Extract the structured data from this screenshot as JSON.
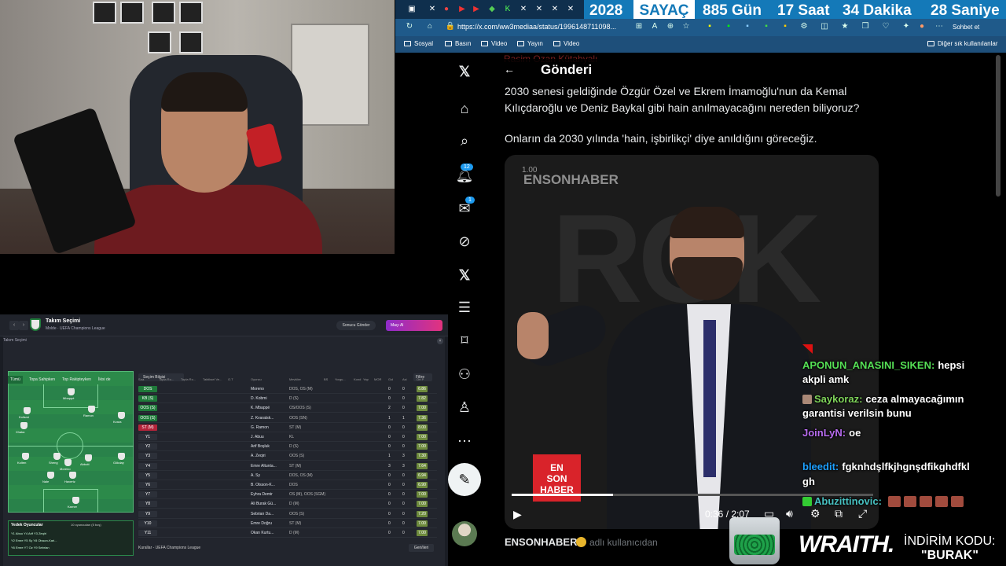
{
  "browser": {
    "url": "https://x.com/ww3mediaa/status/1996148711098...",
    "bookmarks": [
      "Sosyal",
      "Basın",
      "Yayın",
      "Video"
    ],
    "other_bookmarks": "Diğer sık kullanılanlar",
    "chat_button": "Sohbet et"
  },
  "counter": {
    "year": "2028",
    "label": "SAYAÇ",
    "days": "885 Gün",
    "hours": "17 Saat",
    "minutes": "34 Dakika",
    "seconds": "28 Saniye"
  },
  "x": {
    "header_title": "Gönderi",
    "faded_name": "Rasim Ozan Kütahyalı",
    "tweet_lines": [
      "2030 senesi geldiğinde Özgür Özel ve Ekrem İmamoğlu'nun da Kemal",
      "Kılıçdaroğlu ve Deniz Baykal gibi hain anılmayacağını nereden biliyoruz?",
      "Onların da 2030 yılında 'hain, işbirlikçi' diye anıldığını göreceğiz."
    ],
    "notifications_badge": "12",
    "messages_badge": "1",
    "video": {
      "speed": "1.00",
      "brand": "ENSONHABER",
      "bg_text": "ROK",
      "logo_lines": [
        "EN",
        "SON",
        "HABER"
      ],
      "time": "0:36 / 2:07",
      "progress": 0.28
    },
    "author": "ENSONHABER",
    "author_sub": "adlı kullanıcıdan"
  },
  "chat": [
    {
      "user": "APONUN_ANASINI_SIKEN:",
      "msg": "hepsi",
      "cont": "akpli amk",
      "color": "#55e055",
      "badge": "#d11"
    },
    {
      "user": "Saykoraz:",
      "msg": "ceza almayacağımın",
      "cont": "garantisi verilsin bunu",
      "color": "#7fd45a",
      "badge": "#a87"
    },
    {
      "user": "JoinLyN:",
      "msg": "oe",
      "cont": "",
      "color": "#b86cf0",
      "badge": ""
    },
    {
      "user": "bleedit:",
      "msg": "fgknhdşlfkjhgnşdfikghdfkl",
      "cont": "gh",
      "color": "#1ea0ff",
      "badge": ""
    },
    {
      "user": "Abuzittinovic:",
      "msg": "",
      "cont": "",
      "color": "#47c0c0",
      "badge": "#3c3"
    }
  ],
  "sponsor": {
    "brand": "WRAITH.",
    "code_label": "İNDİRİM KODU:",
    "code": "\"BURAK\""
  },
  "game": {
    "title": "Takım Seçimi",
    "subtitle": "Molde  ·  UEFA Champions League",
    "panel_title": "Takım Seçimi",
    "send_btn": "Sonucu Gönder",
    "play_btn": "Maçı Al",
    "pitch_tabs": [
      "Tümü",
      "Topa Sahipken",
      "Top Rakipteyken",
      "İkisi de"
    ],
    "selection_btn": "Seçim Bilgisi",
    "filter_btn": "Filtre",
    "headers": [
      "Sıra",
      "Topla Ro...",
      "Topla Ro...",
      "Taktiksel Ve...",
      "O.T",
      "Oyuncu",
      "Mevkiler",
      "BS",
      "Yorgu...",
      "Kond",
      "Yap",
      "MOR",
      "Gol",
      "Asi",
      "Ort P"
    ],
    "rows": [
      {
        "pos": "DOS",
        "name": "Moreno",
        "role": "DOS, OS (M)",
        "g": "0",
        "a": "0",
        "r": "6.86",
        "c": "#1f7a3a"
      },
      {
        "pos": "KB (S)",
        "name": "D. Kobmi",
        "role": "D (S)",
        "g": "0",
        "a": "0",
        "r": "7.82",
        "c": "#1f7a3a"
      },
      {
        "pos": "OOS (S)",
        "name": "K. Mbappé",
        "role": "OS/OOS (S)",
        "g": "2",
        "a": "0",
        "r": "7.00",
        "c": "#1f7a3a"
      },
      {
        "pos": "OOS (S)",
        "name": "Z. Kvaratsk...",
        "role": "OOS (SN)",
        "g": "1",
        "a": "1",
        "r": "7.36",
        "c": "#1f7a3a"
      },
      {
        "pos": "ST (M)",
        "name": "G. Ramon",
        "role": "ST (M)",
        "g": "0",
        "a": "0",
        "r": "8.00",
        "c": "#b3243a"
      },
      {
        "pos": "Y1",
        "name": "J. Abuu",
        "role": "KL",
        "g": "0",
        "a": "0",
        "r": "7.00",
        "c": "#2c3039"
      },
      {
        "pos": "Y2",
        "name": "Arif Boşluk",
        "role": "D (S)",
        "g": "0",
        "a": "0",
        "r": "7.00",
        "c": "#2c3039"
      },
      {
        "pos": "Y3",
        "name": "A. Zeqiri",
        "role": "OOS (S)",
        "g": "1",
        "a": "3",
        "r": "7.30",
        "c": "#2c3039"
      },
      {
        "pos": "Y4",
        "name": "Emre Altunta...",
        "role": "ST (M)",
        "g": "3",
        "a": "3",
        "r": "7.64",
        "c": "#2c3039"
      },
      {
        "pos": "Y5",
        "name": "A. Sy",
        "role": "DOS, OS (M)",
        "g": "0",
        "a": "0",
        "r": "6.94",
        "c": "#2c3039"
      },
      {
        "pos": "Y6",
        "name": "B. Olsson-K...",
        "role": "DOS",
        "g": "0",
        "a": "0",
        "r": "6.90",
        "c": "#2c3039"
      },
      {
        "pos": "Y7",
        "name": "Eyhra Demir",
        "role": "OS (M), OOS (SGM)",
        "g": "0",
        "a": "0",
        "r": "7.00",
        "c": "#2c3039"
      },
      {
        "pos": "Y8",
        "name": "Ali Burak Gü...",
        "role": "D (M)",
        "g": "0",
        "a": "0",
        "r": "7.00",
        "c": "#2c3039"
      },
      {
        "pos": "Y9",
        "name": "Sebrian Da...",
        "role": "OOS (S)",
        "g": "0",
        "a": "0",
        "r": "7.20",
        "c": "#2c3039"
      },
      {
        "pos": "Y10",
        "name": "Emre Doğru",
        "role": "ST (M)",
        "g": "0",
        "a": "0",
        "r": "7.00",
        "c": "#2c3039"
      },
      {
        "pos": "Y11",
        "name": "Okan Kurtu...",
        "role": "D (M)",
        "g": "0",
        "a": "0",
        "r": "7.00",
        "c": "#2c3039"
      }
    ],
    "subs_title": "Yedek Oyuncular",
    "subs_count": "10 oyuncudan (5 boş)",
    "subs_rows": [
      "Y1 Abuu  Y4 Arif  Y3 Zeqiri",
      "Y2 Emre  Y5 Sy  Y8 Olsson-Kari...",
      "Y6 Emre  Y7 Oz  Y9 Sebrian"
    ],
    "footer": "Kurallar - UEFA Champions League",
    "back_btn": "Geri/ileri",
    "players": [
      "Kolismi",
      "Xhaka",
      "Mbappé",
      "Kvara",
      "Ramon",
      "Moreno",
      "Havertz",
      "Kolten",
      "Gökday",
      "Abbott",
      "Sheng",
      "Nale",
      "Karner"
    ]
  }
}
